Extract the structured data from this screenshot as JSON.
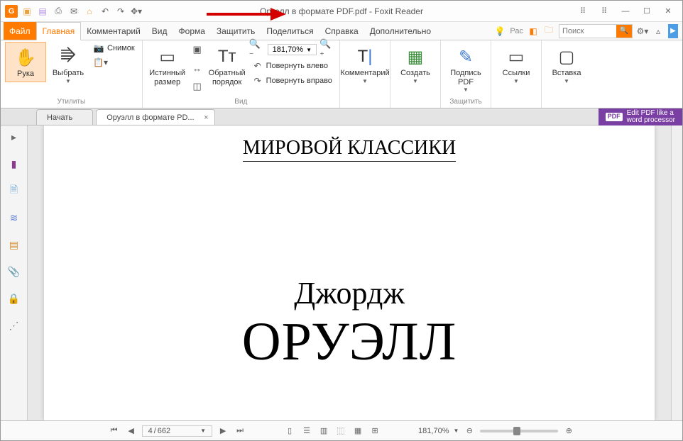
{
  "title": "Оруэлл в формате PDF.pdf - Foxit Reader",
  "qat": {
    "open_icon": "folder-open-icon",
    "save_icon": "save-icon",
    "print_icon": "print-icon",
    "email_icon": "email-icon",
    "undo_icon": "undo-icon",
    "redo_icon": "redo-icon"
  },
  "tabs": {
    "file": "Файл",
    "home": "Главная",
    "comment": "Комментарий",
    "view": "Вид",
    "form": "Форма",
    "protect": "Защитить",
    "share": "Поделиться",
    "help": "Справка",
    "extra": "Дополнительно",
    "ras_label": "Рас"
  },
  "search": {
    "placeholder": "Поиск"
  },
  "ribbon": {
    "utilities": {
      "hand": "Рука",
      "select": "Выбрать",
      "snapshot": "Снимок",
      "group_label": "Утилиты"
    },
    "view": {
      "actual_size": "Истинный размер",
      "reflow": "Обратный порядок",
      "zoom_value": "181,70%",
      "rotate_left": "Повернуть влево",
      "rotate_right": "Повернуть вправо",
      "group_label": "Вид"
    },
    "comment_group": {
      "label": "Комментарий"
    },
    "create": {
      "label": "Создать"
    },
    "protect": {
      "sign": "Подпись PDF",
      "group_label": "Защитить"
    },
    "links": {
      "label": "Ссылки"
    },
    "insert": {
      "label": "Вставка"
    }
  },
  "doc_tabs": {
    "start": "Начать",
    "doc": "Оруэлл в формате PD..."
  },
  "promo": {
    "line1": "Edit PDF like a",
    "line2": "word processor",
    "badge": "PDF"
  },
  "content": {
    "heading": "МИРОВОЙ КЛАССИКИ",
    "author_first": "Джордж",
    "author_last": "ОРУЭЛЛ"
  },
  "status": {
    "page_current": "4",
    "page_total": "662",
    "zoom": "181,70%"
  }
}
